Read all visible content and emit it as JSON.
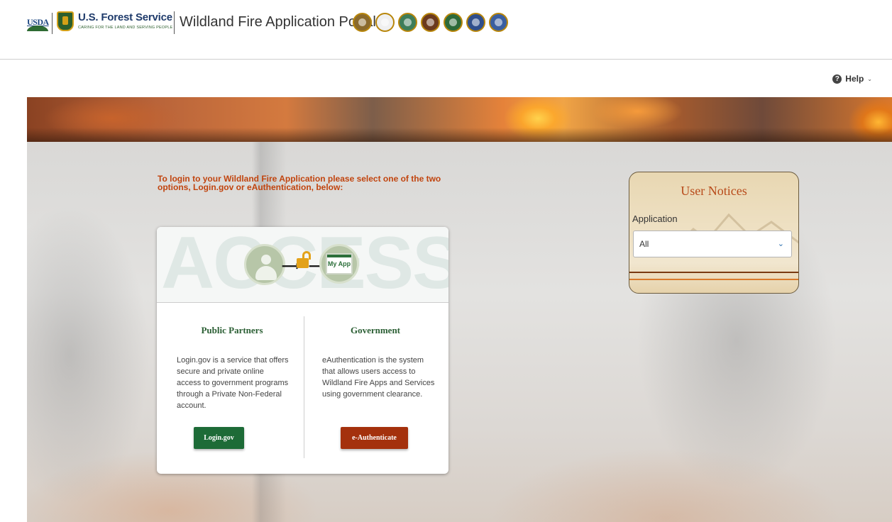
{
  "header": {
    "usda_label": "USDA",
    "agency_name": "U.S. Forest Service",
    "agency_tagline": "CARING FOR THE LAND AND SERVING PEOPLE",
    "portal_title": "Wildland Fire Application Portal",
    "agency_seals": [
      {
        "name": "bia-seal",
        "color": "#8a6a2c"
      },
      {
        "name": "eagle-seal",
        "color": "#f0f0f0"
      },
      {
        "name": "blm-seal",
        "color": "#3e7d5a"
      },
      {
        "name": "nps-seal",
        "color": "#6b3a1e"
      },
      {
        "name": "forest-seal",
        "color": "#2d6a3a"
      },
      {
        "name": "dod-seal",
        "color": "#2f4e8c"
      },
      {
        "name": "fws-seal",
        "color": "#3a5ea0"
      }
    ]
  },
  "help": {
    "label": "Help",
    "icon": "question-circle-icon"
  },
  "main": {
    "instruction": "To login to your Wildland Fire Application please select one of the two options, Login.gov or eAuthentication, below:",
    "access_card": {
      "banner_word": "ACCESS",
      "app_label": "My App",
      "public_partners": {
        "title": "Public Partners",
        "description": "Login.gov is a service that offers secure and private online access to government programs through a Private Non-Federal account.",
        "button_label": "Login.gov"
      },
      "government": {
        "title": "Government",
        "description": "eAuthentication is the system that allows users access to Wildland Fire Apps and Services using government clearance.",
        "button_label": "e-Authenticate"
      }
    }
  },
  "notices": {
    "title": "User Notices",
    "application_label": "Application",
    "application_selected": "All"
  },
  "colors": {
    "accent_orange": "#c1440e",
    "forest_green": "#1d6b37",
    "rust": "#a4310d"
  }
}
